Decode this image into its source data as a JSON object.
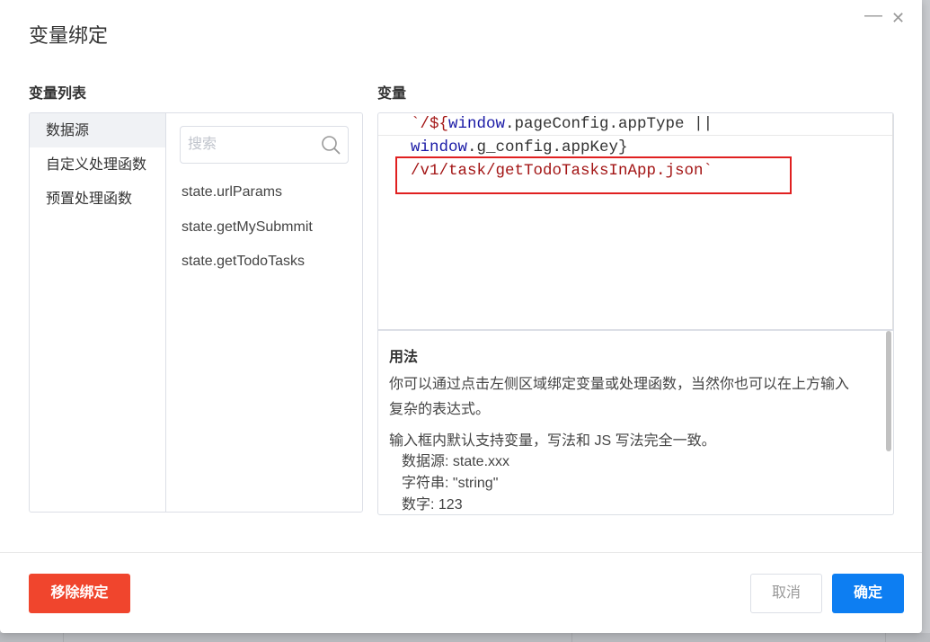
{
  "dialog": {
    "title": "变量绑定",
    "minimize_glyph": "—",
    "close_glyph": "✕"
  },
  "left_panel": {
    "label": "变量列表",
    "categories": [
      {
        "label": "数据源",
        "active": true
      },
      {
        "label": "自定义处理函数",
        "active": false
      },
      {
        "label": "预置处理函数",
        "active": false
      }
    ],
    "search": {
      "placeholder": "搜索",
      "value": "",
      "icon": "search-icon"
    },
    "items": [
      "state.urlParams",
      "state.getMySubmmit",
      "state.getTodoTasks"
    ]
  },
  "right_panel": {
    "label": "变量",
    "code": {
      "line1": {
        "t1": "`/${",
        "t2": "window",
        "t3": ".pageConfig.appType ||"
      },
      "line2": {
        "t1": "window",
        "t2": ".g_config.appKey}"
      },
      "line3": {
        "t1": "/v1/task/getTodoTasksInApp.json`"
      }
    },
    "usage": {
      "title": "用法",
      "p1a": "你可以通过点击左侧区域绑定变量或处理函数，当然你也可以在上方输入",
      "p1b": "复杂的表达式。",
      "p2": "输入框内默认支持变量，写法和 JS 写法完全一致。",
      "ex1": "数据源: state.xxx",
      "ex2": "字符串: \"string\"",
      "ex3": "数字: 123"
    }
  },
  "footer": {
    "remove_label": "移除绑定",
    "cancel_label": "取消",
    "ok_label": "确定"
  },
  "colors": {
    "primary": "#0d7ef2",
    "danger": "#f0452d",
    "highlight_box": "#e02020",
    "code_string": "#a31515",
    "code_variable": "#1a1aa6"
  }
}
